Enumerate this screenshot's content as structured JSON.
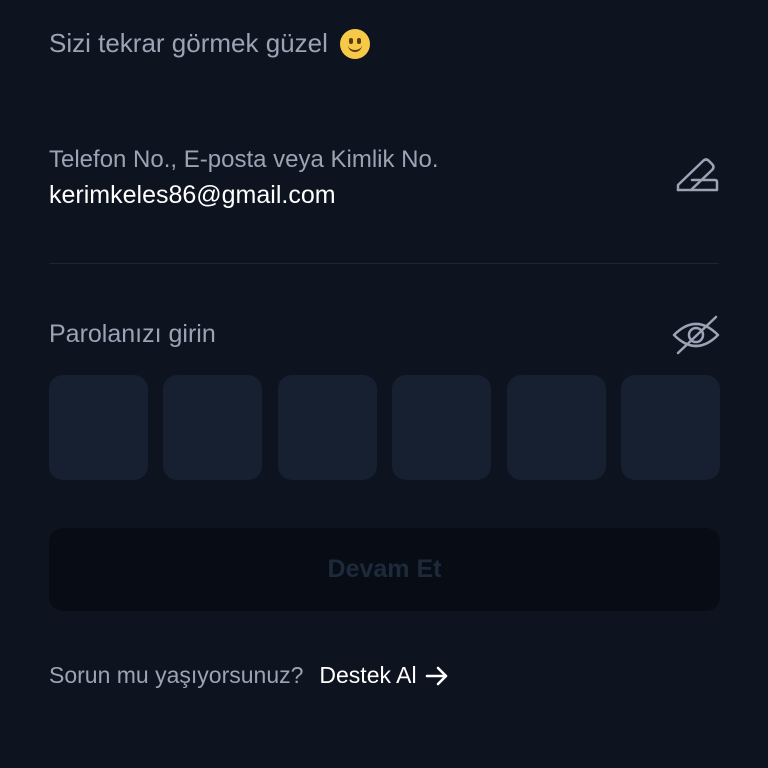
{
  "greeting": {
    "text": "Sizi tekrar görmek güzel",
    "emoji_icon": "smiley-face-icon"
  },
  "identifier": {
    "label": "Telefon No., E-posta veya Kimlik No.",
    "value": "kerimkeles86@gmail.com",
    "edit_icon": "edit-pencil-icon"
  },
  "password": {
    "label": "Parolanızı girin",
    "visibility_icon": "eye-slash-icon",
    "pin_length": 6,
    "pin_values": [
      "",
      "",
      "",
      "",
      "",
      ""
    ]
  },
  "continue_button": {
    "label": "Devam Et",
    "enabled": false
  },
  "help": {
    "question": "Sorun mu yaşıyorsunuz?",
    "link_label": "Destek Al",
    "link_icon": "arrow-right-icon"
  },
  "colors": {
    "background": "#0d131f",
    "muted_text": "#9ba3b4",
    "primary_text": "#ffffff",
    "pin_box": "#172030",
    "button_disabled_bg": "#080c14",
    "button_disabled_text": "#1c2a3c"
  }
}
